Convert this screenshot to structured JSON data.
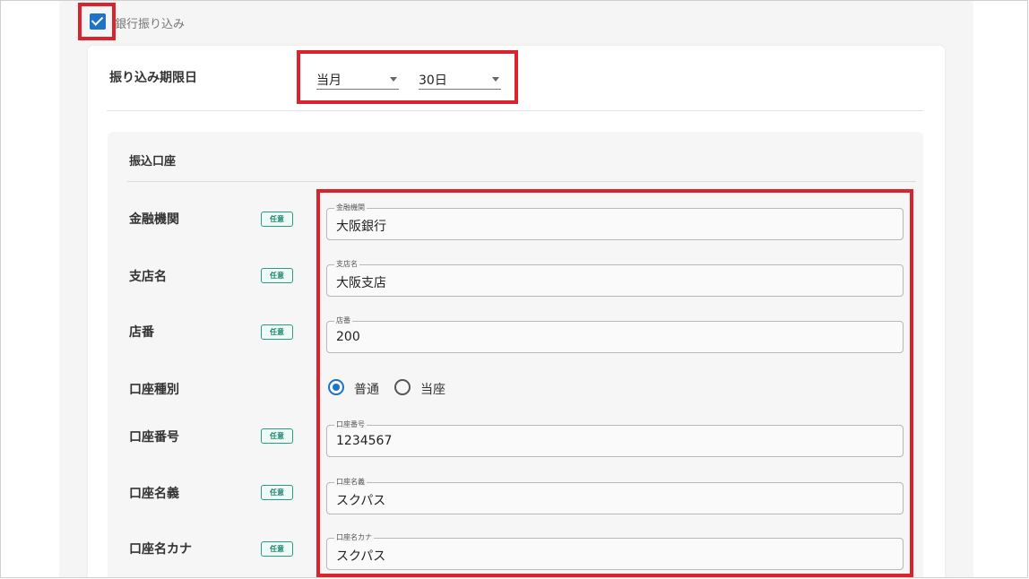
{
  "bank_transfer": {
    "label": "銀行振り込み",
    "checked": true
  },
  "deadline": {
    "label": "振り込み期限日",
    "month_value": "当月",
    "day_value": "30日"
  },
  "account": {
    "section_title": "振込口座",
    "optional_badge": "任意",
    "rows": {
      "bank": {
        "label": "金融機関",
        "legend": "金融機関",
        "value": "大阪銀行"
      },
      "branch": {
        "label": "支店名",
        "legend": "支店名",
        "value": "大阪支店"
      },
      "branch_no": {
        "label": "店番",
        "legend": "店番",
        "value": "200"
      },
      "account_type": {
        "label": "口座種別",
        "options": [
          "普通",
          "当座"
        ],
        "selected": "普通"
      },
      "account_no": {
        "label": "口座番号",
        "legend": "口座番号",
        "value": "1234567"
      },
      "holder": {
        "label": "口座名義",
        "legend": "口座名義",
        "value": "スクパス"
      },
      "holder_kana": {
        "label": "口座名カナ",
        "legend": "口座名カナ",
        "value": "スクパス"
      }
    }
  },
  "colors": {
    "highlight": "#d9232d",
    "accent": "#1e73c9",
    "badge": "#2a9a86"
  }
}
